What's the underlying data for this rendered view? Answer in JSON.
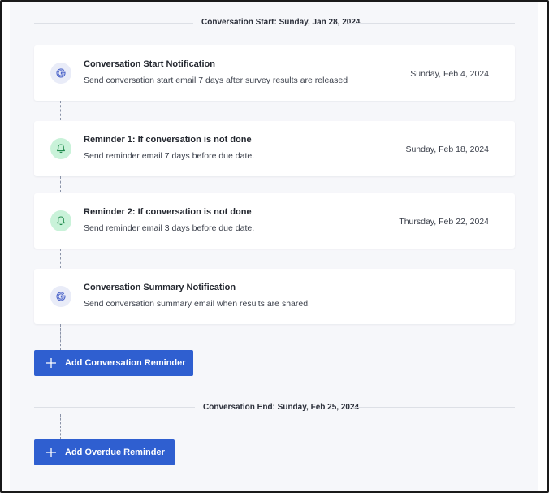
{
  "timeline": {
    "start_label": "Conversation Start: Sunday, Jan 28, 2024",
    "end_label": "Conversation End: Sunday, Feb 25, 2024"
  },
  "cards": [
    {
      "icon": "g-icon",
      "title": "Conversation Start Notification",
      "description": "Send conversation start email 7 days after survey results are released",
      "date": "Sunday, Feb 4, 2024"
    },
    {
      "icon": "bell-icon",
      "title": "Reminder 1: If conversation is not done",
      "description": "Send reminder email 7 days before due date.",
      "date": "Sunday, Feb 18, 2024"
    },
    {
      "icon": "bell-icon",
      "title": "Reminder 2: If conversation is not done",
      "description": "Send reminder email 3 days before due date.",
      "date": "Thursday, Feb 22, 2024"
    },
    {
      "icon": "g-icon",
      "title": "Conversation Summary Notification",
      "description": "Send conversation summary email when results are shared.",
      "date": ""
    }
  ],
  "buttons": {
    "add_conversation_reminder": "Add Conversation Reminder",
    "add_overdue_reminder": "Add Overdue Reminder"
  },
  "colors": {
    "primary": "#2f5fd0",
    "bell_bg": "#c9f2d9",
    "bell_fg": "#1f8a4c",
    "g_bg": "#e9ecf8",
    "g_fg": "#4a63c9"
  }
}
